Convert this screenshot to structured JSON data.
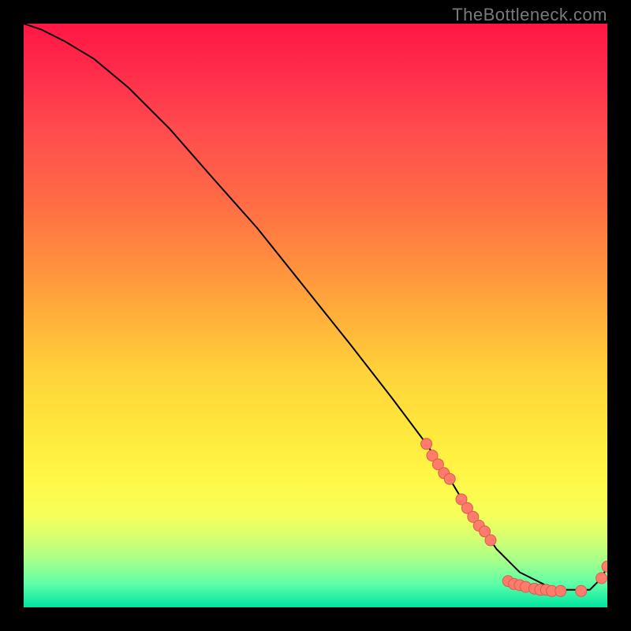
{
  "attribution": "TheBottleneck.com",
  "colors": {
    "page_bg": "#000000",
    "curve": "#000000",
    "marker_fill": "#ff7b6b",
    "marker_stroke": "#d95b4d",
    "gradient_top": "#ff1744",
    "gradient_bottom": "#00e3a0"
  },
  "chart_data": {
    "type": "line",
    "title": "",
    "xlabel": "",
    "ylabel": "",
    "xlim": [
      0,
      100
    ],
    "ylim": [
      0,
      100
    ],
    "grid": false,
    "legend": false,
    "series": [
      {
        "name": "bottleneck-curve",
        "x": [
          0,
          3,
          7,
          12,
          18,
          25,
          32,
          40,
          48,
          56,
          63,
          69,
          73,
          76,
          79,
          81,
          83,
          85,
          87,
          89,
          91,
          93,
          95,
          97,
          99,
          100
        ],
        "y": [
          100,
          99,
          97,
          94,
          89,
          82,
          74,
          65,
          55,
          45,
          36,
          28,
          22,
          17,
          13,
          10,
          8,
          6,
          5,
          4,
          3,
          3,
          3,
          3,
          5,
          7
        ]
      }
    ],
    "markers": [
      {
        "x": 69,
        "y": 28
      },
      {
        "x": 70,
        "y": 26
      },
      {
        "x": 71,
        "y": 24.5
      },
      {
        "x": 72,
        "y": 23
      },
      {
        "x": 73,
        "y": 22
      },
      {
        "x": 75,
        "y": 18.5
      },
      {
        "x": 76,
        "y": 17
      },
      {
        "x": 77,
        "y": 15.5
      },
      {
        "x": 78,
        "y": 14
      },
      {
        "x": 79,
        "y": 13
      },
      {
        "x": 80,
        "y": 11.5
      },
      {
        "x": 83,
        "y": 4.5
      },
      {
        "x": 84,
        "y": 4
      },
      {
        "x": 85,
        "y": 3.8
      },
      {
        "x": 86,
        "y": 3.5
      },
      {
        "x": 87.5,
        "y": 3.2
      },
      {
        "x": 88.5,
        "y": 3
      },
      {
        "x": 89.5,
        "y": 3
      },
      {
        "x": 90.5,
        "y": 2.8
      },
      {
        "x": 92,
        "y": 2.8
      },
      {
        "x": 95.5,
        "y": 2.8
      },
      {
        "x": 99,
        "y": 5
      },
      {
        "x": 100,
        "y": 7
      }
    ],
    "notes": "y-axis inverted visually (0 at bottom, 100 at top). Markers cluster along the lower-right portion of the curve near the valley and the small upturn at the right edge."
  }
}
